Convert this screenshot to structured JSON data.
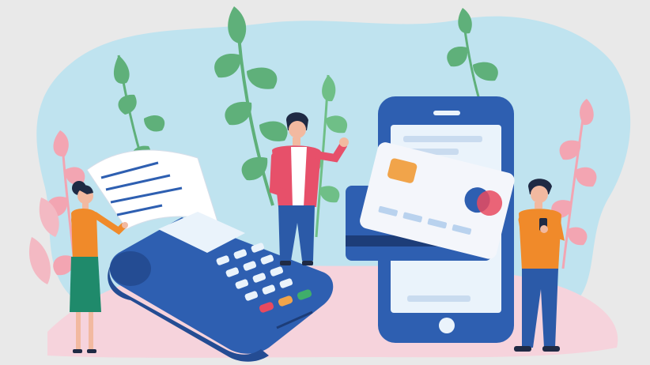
{
  "scene": {
    "subject": "payment-illustration",
    "palette": {
      "background": "#e9e9e9",
      "blob": "#bfe3ef",
      "floor_pink": "#f6d3dc",
      "leaf_green": "#5fb07a",
      "leaf_pink": "#f3a5b2",
      "device_blue": "#2e5fb1",
      "device_dark": "#244c93",
      "screen_light": "#eaf3fb",
      "card_white": "#f4f6fb",
      "chip_orange": "#f1a44a",
      "logo_red": "#e84a5f",
      "shirt_orange": "#f08a2a",
      "jacket_pink": "#e7506a",
      "pants_blue": "#2b5aa8",
      "skirt_green": "#1f8a6b",
      "hair_dark": "#1f2a44"
    },
    "icons": [
      "leaf-plant-icon",
      "receipt-icon",
      "pos-terminal-icon",
      "smartphone-icon",
      "credit-card-icon",
      "person-icon"
    ]
  }
}
